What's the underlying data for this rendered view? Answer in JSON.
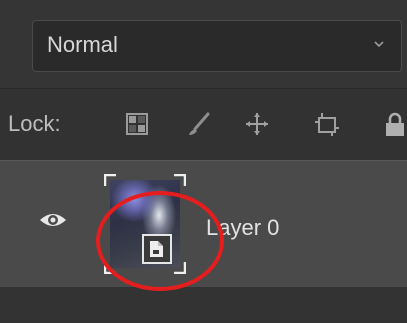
{
  "blend": {
    "mode": "Normal",
    "icon": "chevron-down-icon"
  },
  "lock": {
    "label": "Lock:",
    "icons": [
      "lock-transparent-pixels-icon",
      "lock-image-pixels-icon",
      "lock-position-icon",
      "lock-artboard-icon",
      "lock-all-icon"
    ]
  },
  "layer": {
    "name": "Layer 0",
    "visible": true,
    "eye_icon": "eye-icon",
    "badge_icon": "smart-object-icon"
  },
  "annotation": {
    "color": "#e41e1e",
    "shape": "ellipse"
  },
  "colors": {
    "panel": "#323232",
    "selected_row": "#4a4a4a",
    "text": "#e3e3e3"
  }
}
